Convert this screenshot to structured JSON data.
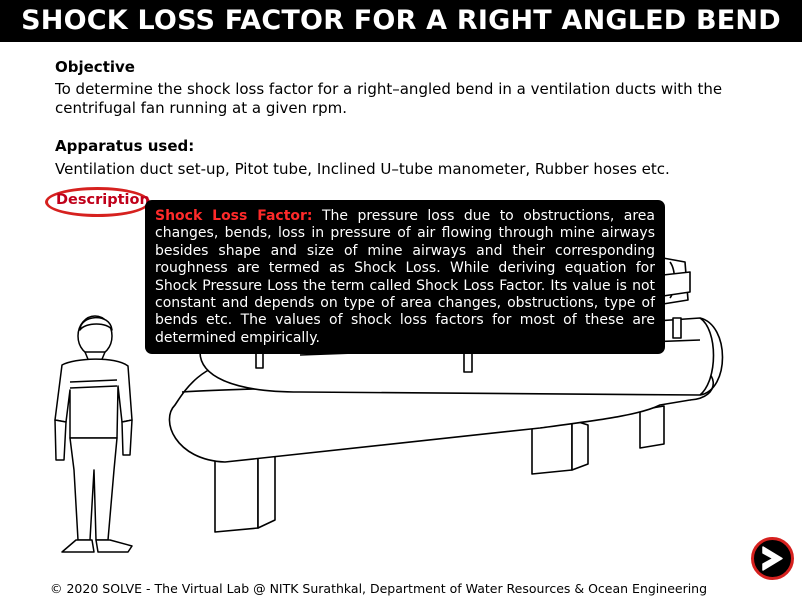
{
  "header": {
    "title": "SHOCK LOSS FACTOR FOR A RIGHT ANGLED BEND"
  },
  "objective": {
    "heading": "Objective",
    "text": "To determine the shock loss factor for a right–angled bend in a ventilation ducts with the centrifugal fan running at a given rpm."
  },
  "apparatus": {
    "heading": "Apparatus used:",
    "text": "Ventilation duct set-up, Pitot tube, Inclined U–tube manometer, Rubber hoses etc."
  },
  "description": {
    "tab_label": "Description",
    "term": "Shock Loss Factor:",
    "text": " The pressure loss due to obstructions, area changes, bends, loss in pressure of air flowing through mine airways besides shape and size of mine airways and their corresponding roughness are termed as Shock Loss. While deriving equation for Shock Pressure Loss the term called Shock Loss Factor. Its value is not constant and depends on type of area changes, obstructions, type of bends etc. The values of shock loss factors for most of these are determined empirically."
  },
  "footer": {
    "text": "© 2020 SOLVE - The Virtual Lab @ NITK Surathkal, Department of Water Resources & Ocean Engineering"
  },
  "navigation": {
    "next_icon": "next-arrow-icon"
  },
  "colors": {
    "title_bg": "#000000",
    "accent_red": "#d6211f",
    "tooltip_bg": "#000000",
    "term_red": "#ff2a2a"
  }
}
